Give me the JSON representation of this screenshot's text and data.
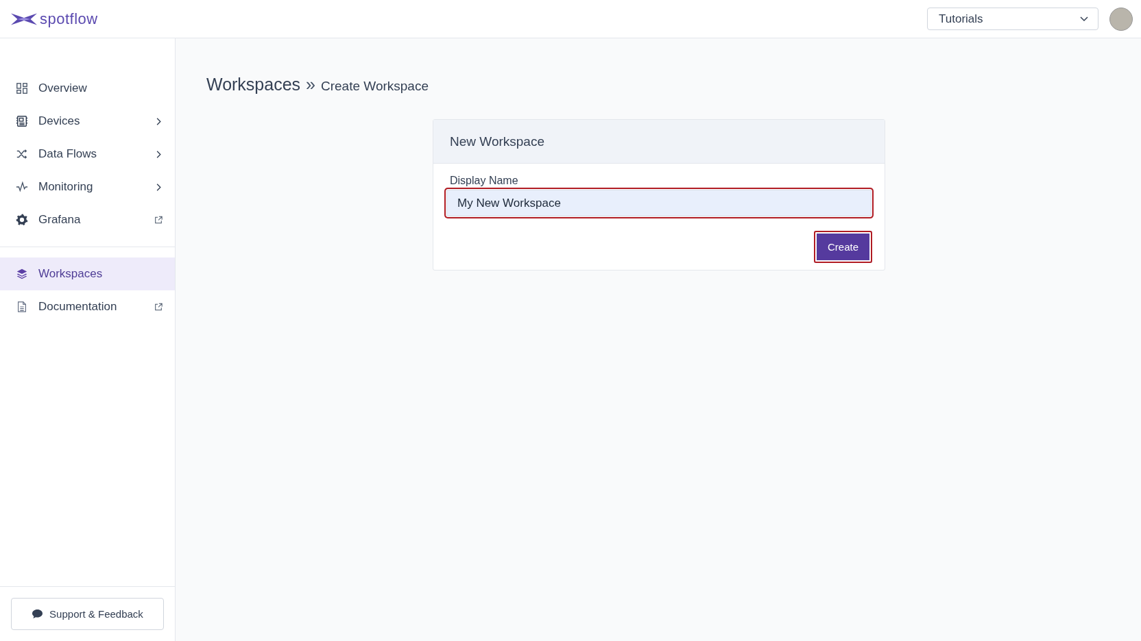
{
  "header": {
    "logo_text": "spotflow",
    "selector": {
      "value": "Tutorials"
    }
  },
  "sidebar": {
    "main_items": [
      {
        "label": "Overview",
        "selected": false,
        "kind": "plain"
      },
      {
        "label": "Devices",
        "selected": false,
        "kind": "submenu"
      },
      {
        "label": "Data Flows",
        "selected": false,
        "kind": "submenu"
      },
      {
        "label": "Monitoring",
        "selected": false,
        "kind": "submenu"
      },
      {
        "label": "Grafana",
        "selected": false,
        "kind": "external"
      }
    ],
    "secondary_items": [
      {
        "label": "Workspaces",
        "selected": true,
        "kind": "plain"
      },
      {
        "label": "Documentation",
        "selected": false,
        "kind": "external"
      }
    ],
    "support_button": "Support & Feedback"
  },
  "breadcrumb": {
    "parent": "Workspaces",
    "separator": "»",
    "current": "Create Workspace"
  },
  "card": {
    "title": "New Workspace",
    "field": {
      "label": "Display Name",
      "value": "My New Workspace",
      "highlighted": true
    },
    "button": {
      "label": "Create",
      "highlighted": true
    }
  }
}
